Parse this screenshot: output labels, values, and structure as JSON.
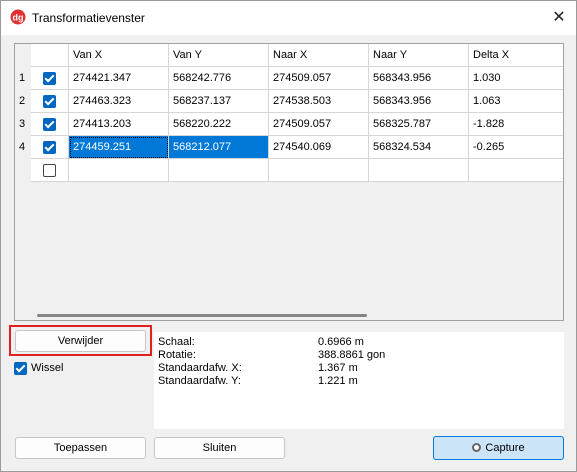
{
  "window": {
    "title": "Transformatievenster",
    "icon": "app-logo-icon",
    "close_glyph": "✕"
  },
  "grid": {
    "columns": [
      "Van X",
      "Van Y",
      "Naar X",
      "Naar Y",
      "Delta X"
    ],
    "rows": [
      {
        "num": "1",
        "checked": true,
        "cells": [
          "274421.347",
          "568242.776",
          "274509.057",
          "568343.956",
          "1.030"
        ]
      },
      {
        "num": "2",
        "checked": true,
        "cells": [
          "274463.323",
          "568237.137",
          "274538.503",
          "568343.956",
          "1.063"
        ]
      },
      {
        "num": "3",
        "checked": true,
        "cells": [
          "274413.203",
          "568220.222",
          "274509.057",
          "568325.787",
          "-1.828"
        ]
      },
      {
        "num": "4",
        "checked": true,
        "cells": [
          "274459.251",
          "568212.077",
          "274540.069",
          "568324.534",
          "-0.265"
        ],
        "selected": true
      },
      {
        "num": "",
        "checked": false,
        "cells": [
          "",
          "",
          "",
          "",
          ""
        ]
      }
    ]
  },
  "actions": {
    "verwijder": "Verwijder",
    "wissel": "Wissel",
    "wissel_checked": true,
    "toepassen": "Toepassen",
    "sluiten": "Sluiten",
    "capture": "Capture"
  },
  "stats": [
    {
      "label": "Schaal:",
      "value": "0.6966 m"
    },
    {
      "label": "Rotatie:",
      "value": "388.8861 gon"
    },
    {
      "label": "Standaardafw. X:",
      "value": "1.367 m"
    },
    {
      "label": "Standaardafw. Y:",
      "value": "1.221 m"
    }
  ],
  "colors": {
    "selection": "#0078d7",
    "highlight_box": "#e02020",
    "accent": "#0067c0"
  }
}
